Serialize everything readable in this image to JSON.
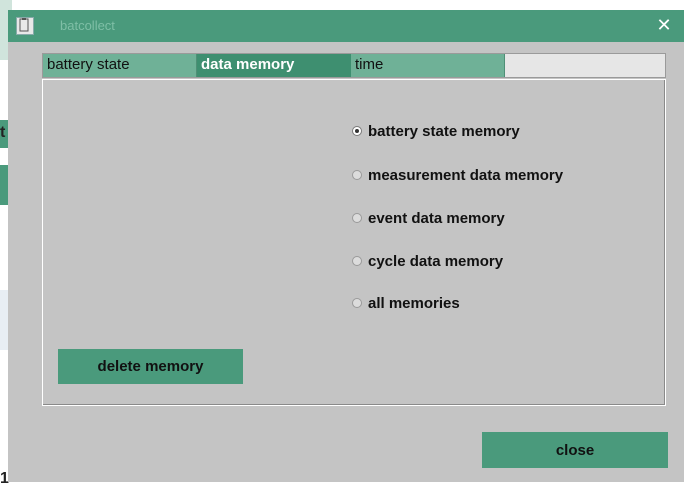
{
  "window": {
    "title": "batcollect",
    "close_glyph": "✕"
  },
  "tabs": [
    {
      "label": "battery state",
      "active": false
    },
    {
      "label": "data memory",
      "active": true
    },
    {
      "label": "time",
      "active": false
    }
  ],
  "memory_options": [
    {
      "label": "battery state memory",
      "selected": true
    },
    {
      "label": "measurement data memory",
      "selected": false
    },
    {
      "label": "event data memory",
      "selected": false
    },
    {
      "label": "cycle data memory",
      "selected": false
    },
    {
      "label": "all memories",
      "selected": false
    }
  ],
  "buttons": {
    "delete_label": "delete memory",
    "close_label": "close"
  },
  "background_app": {
    "edge_text_1": "t",
    "edge_text_2": "1"
  },
  "colors": {
    "accent": "#4a9a7c",
    "tab_active": "#3e8f70",
    "tab_normal": "#6fb197",
    "dialog_bg": "#c4c4c4"
  }
}
